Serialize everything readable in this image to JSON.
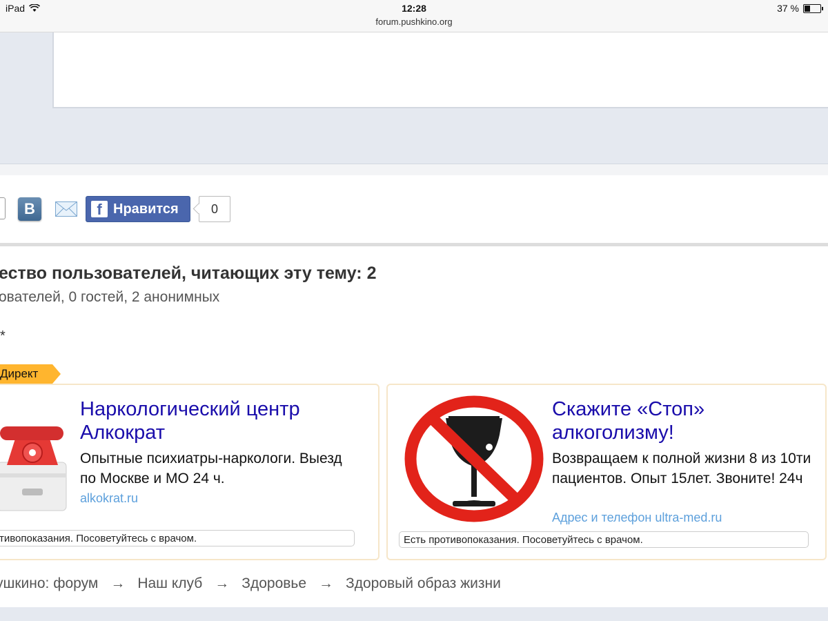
{
  "status_bar": {
    "device": "iPad",
    "time": "12:28",
    "url": "forum.pushkino.org",
    "battery_text": "37 %",
    "battery_level": 0.37
  },
  "social": {
    "vk_label": "B",
    "like_label": "Нравится",
    "like_count": "0",
    "icons": [
      "vk-icon",
      "mail-icon",
      "facebook-icon"
    ]
  },
  "readers": {
    "title": "ество пользователей, читающих эту тему: 2",
    "subtitle": "ователей, 0 гостей, 2 анонимных",
    "marker": "*"
  },
  "direct": {
    "tag": "Директ"
  },
  "ads": [
    {
      "title": "Наркологический центр Алкократ",
      "text": "Опытные психиатры-наркологи. Выезд по Москве и МО 24 ч.",
      "link": "alkokrat.ru",
      "warning": "тивопоказания. Посоветуйтесь с врачом."
    },
    {
      "title": "Скажите «Стоп» алкоголизму!",
      "text": "Возвращаем к полной жизни 8 из 10ти пациентов. Опыт 15лет. Звоните! 24ч",
      "link": "Адрес и телефон  ultra-med.ru",
      "warning": "Есть противопоказания. Посоветуйтесь с врачом."
    }
  ],
  "breadcrumb": {
    "items": [
      "ушкино: форум",
      "Наш клуб",
      "Здоровье",
      "Здоровый образ жизни"
    ],
    "separator": "→"
  },
  "colors": {
    "link_title": "#1a0dab",
    "link_domain": "#5da0dc",
    "facebook": "#4a66ad",
    "direct_tag": "#ffb52e"
  }
}
